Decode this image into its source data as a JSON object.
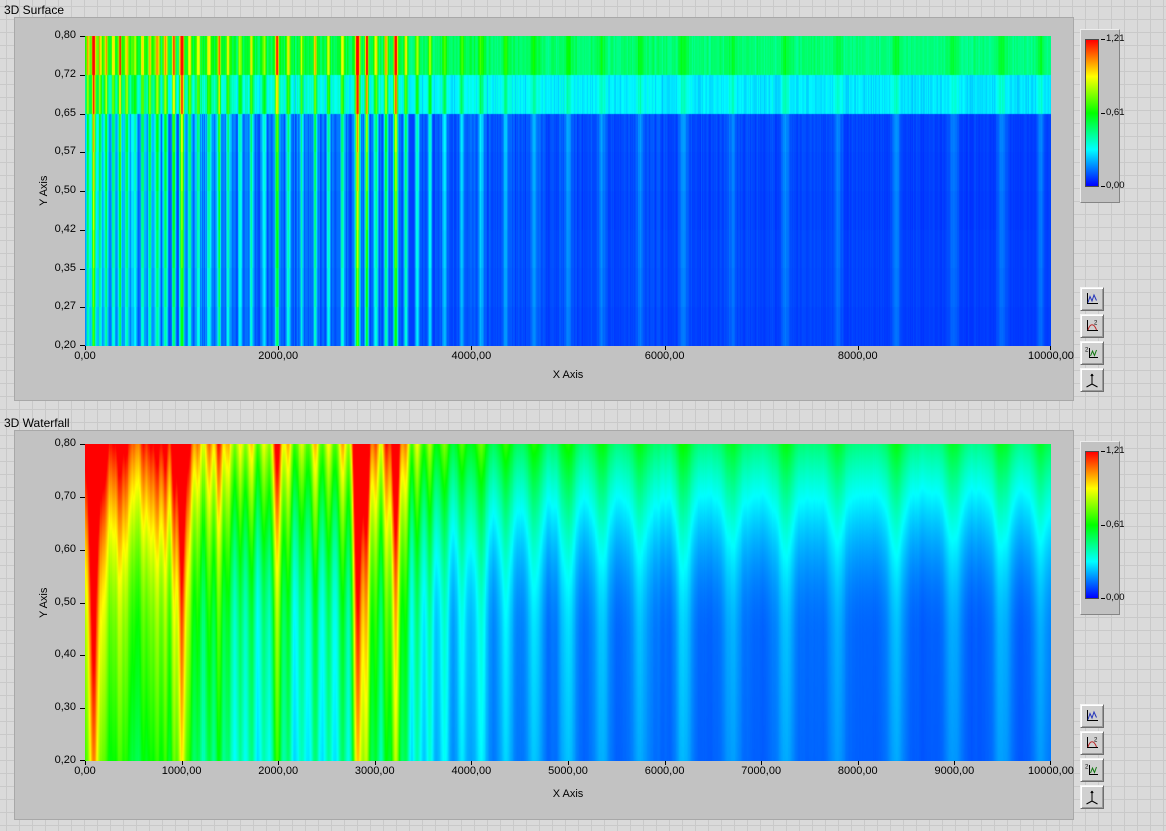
{
  "panels": [
    {
      "title": "3D Surface",
      "x_axis_label": "X Axis",
      "y_axis_label": "Y Axis",
      "x_ticks": [
        "0,00",
        "2000,00",
        "4000,00",
        "6000,00",
        "8000,00",
        "10000,00"
      ],
      "y_ticks": [
        "0,80",
        "0,72",
        "0,65",
        "0,57",
        "0,50",
        "0,42",
        "0,35",
        "0,27",
        "0,20"
      ],
      "colorbar": {
        "ticks": [
          "1,21",
          "0,61",
          "0,00"
        ]
      },
      "toolbar_icons": [
        "plot-projection-icon",
        "x-squared-projection-icon",
        "y-squared-projection-icon",
        "3d-axes-icon"
      ]
    },
    {
      "title": "3D Waterfall",
      "x_axis_label": "X Axis",
      "y_axis_label": "Y Axis",
      "x_ticks": [
        "0,00",
        "1000,00",
        "2000,00",
        "3000,00",
        "4000,00",
        "5000,00",
        "6000,00",
        "7000,00",
        "8000,00",
        "9000,00",
        "10000,00"
      ],
      "y_ticks": [
        "0,80",
        "0,70",
        "0,60",
        "0,50",
        "0,40",
        "0,30",
        "0,20"
      ],
      "colorbar": {
        "ticks": [
          "1,21",
          "0,61",
          "0,00"
        ]
      },
      "toolbar_icons": [
        "plot-projection-icon",
        "x-squared-projection-icon",
        "y-squared-projection-icon",
        "3d-axes-icon"
      ]
    }
  ],
  "chart_data": [
    {
      "type": "heatmap",
      "title": "3D Surface",
      "xlabel": "X Axis",
      "ylabel": "Y Axis",
      "xlim": [
        0,
        10000
      ],
      "ylim": [
        0.2,
        0.8
      ],
      "zlim": [
        0,
        1.21
      ],
      "x_tick_values": [
        0,
        2000,
        4000,
        6000,
        8000,
        10000
      ],
      "y_tick_values": [
        0.8,
        0.72,
        0.65,
        0.57,
        0.5,
        0.42,
        0.35,
        0.27,
        0.2
      ],
      "colorbar_ticks": [
        1.21,
        0.61,
        0.0
      ],
      "colormap_stops": [
        "#0000ff",
        "#00ffff",
        "#00ff00",
        "#ffff00",
        "#ff0000"
      ],
      "legend_position": "right",
      "grid": false,
      "description": "Top-down view of a 3D surface: mostly deep blue background with sharp vertical spectral lines concentrated below x=3500 (strongest near x=1000, 2000, 2820, 3215); the top band (y=0.72..0.80) is elevated (cyan/green) across all x; intensity quantized into 8 horizontal rows.",
      "peaks": [
        [
          30,
          0.4,
          14
        ],
        [
          85,
          0.95,
          12
        ],
        [
          150,
          0.48,
          12
        ],
        [
          215,
          0.55,
          12
        ],
        [
          290,
          0.42,
          12
        ],
        [
          360,
          0.5,
          12
        ],
        [
          430,
          0.45,
          12
        ],
        [
          510,
          0.38,
          12
        ],
        [
          590,
          0.52,
          12
        ],
        [
          665,
          0.4,
          12
        ],
        [
          745,
          0.5,
          14
        ],
        [
          830,
          0.55,
          12
        ],
        [
          915,
          0.6,
          12
        ],
        [
          1000,
          0.92,
          14
        ],
        [
          1080,
          0.5,
          12
        ],
        [
          1170,
          0.4,
          12
        ],
        [
          1280,
          0.45,
          12
        ],
        [
          1385,
          0.55,
          12
        ],
        [
          1480,
          0.38,
          12
        ],
        [
          1600,
          0.36,
          12
        ],
        [
          1720,
          0.42,
          12
        ],
        [
          1850,
          0.34,
          12
        ],
        [
          1985,
          0.72,
          14
        ],
        [
          2100,
          0.4,
          12
        ],
        [
          2240,
          0.34,
          12
        ],
        [
          2380,
          0.45,
          12
        ],
        [
          2520,
          0.38,
          12
        ],
        [
          2660,
          0.5,
          12
        ],
        [
          2820,
          1.1,
          16
        ],
        [
          2915,
          0.82,
          12
        ],
        [
          3010,
          0.48,
          12
        ],
        [
          3115,
          0.55,
          12
        ],
        [
          3215,
          0.92,
          14
        ],
        [
          3320,
          0.48,
          12
        ],
        [
          3440,
          0.38,
          12
        ],
        [
          3570,
          0.3,
          12
        ],
        [
          3720,
          0.24,
          14
        ],
        [
          3900,
          0.18,
          16
        ],
        [
          4100,
          0.2,
          18
        ],
        [
          4350,
          0.15,
          20
        ],
        [
          4650,
          0.12,
          22
        ],
        [
          5000,
          0.15,
          22
        ],
        [
          5350,
          0.11,
          24
        ],
        [
          5750,
          0.1,
          24
        ],
        [
          6200,
          0.12,
          26
        ],
        [
          6700,
          0.09,
          26
        ],
        [
          7250,
          0.11,
          28
        ],
        [
          7800,
          0.09,
          28
        ],
        [
          8400,
          0.11,
          30
        ],
        [
          9000,
          0.09,
          30
        ],
        [
          9500,
          0.11,
          30
        ],
        [
          9900,
          0.1,
          26
        ]
      ],
      "render": {
        "seed": 1234,
        "quantize_rows": 8,
        "width_scale": 1.0,
        "base_level": 0.05,
        "signal_floor": 0.55,
        "signal_gain": 0.45,
        "top_band_amp": 0.34,
        "noise_base": 0.035,
        "noise_amp": 0.3,
        "noise_decay": 3200
      }
    },
    {
      "type": "heatmap",
      "title": "3D Waterfall",
      "xlabel": "X Axis",
      "ylabel": "Y Axis",
      "xlim": [
        0,
        10000
      ],
      "ylim": [
        0.2,
        0.8
      ],
      "zlim": [
        0,
        1.21
      ],
      "x_tick_values": [
        0,
        1000,
        2000,
        3000,
        4000,
        5000,
        6000,
        7000,
        8000,
        9000,
        10000
      ],
      "y_tick_values": [
        0.8,
        0.7,
        0.6,
        0.5,
        0.4,
        0.3,
        0.2
      ],
      "colorbar_ticks": [
        1.21,
        0.61,
        0.0
      ],
      "colormap_stops": [
        "#0000ff",
        "#00ffff",
        "#00ff00",
        "#ffff00",
        "#ff0000"
      ],
      "legend_position": "right",
      "grid": false,
      "description": "Same data as the surface plot rendered as a smooth waterfall: blurred glowing vertical lines on a lighter blue field, with a smooth cyan/green brightening gradient toward y=0.8.",
      "peaks": "same_as_chart_0",
      "render": {
        "seed": 1234,
        "width_scale": 2.2,
        "blur": 2,
        "glow": 9,
        "core_mix": 0.75,
        "glow_mix": 0.35,
        "base_level": 0.08,
        "signal_floor": 0.85,
        "signal_gain": 0.45,
        "top_band_amp": 0.32,
        "top_grad_start": 0.38,
        "noise_base": 0.035,
        "noise_amp": 0.3,
        "noise_decay": 3200
      }
    }
  ]
}
